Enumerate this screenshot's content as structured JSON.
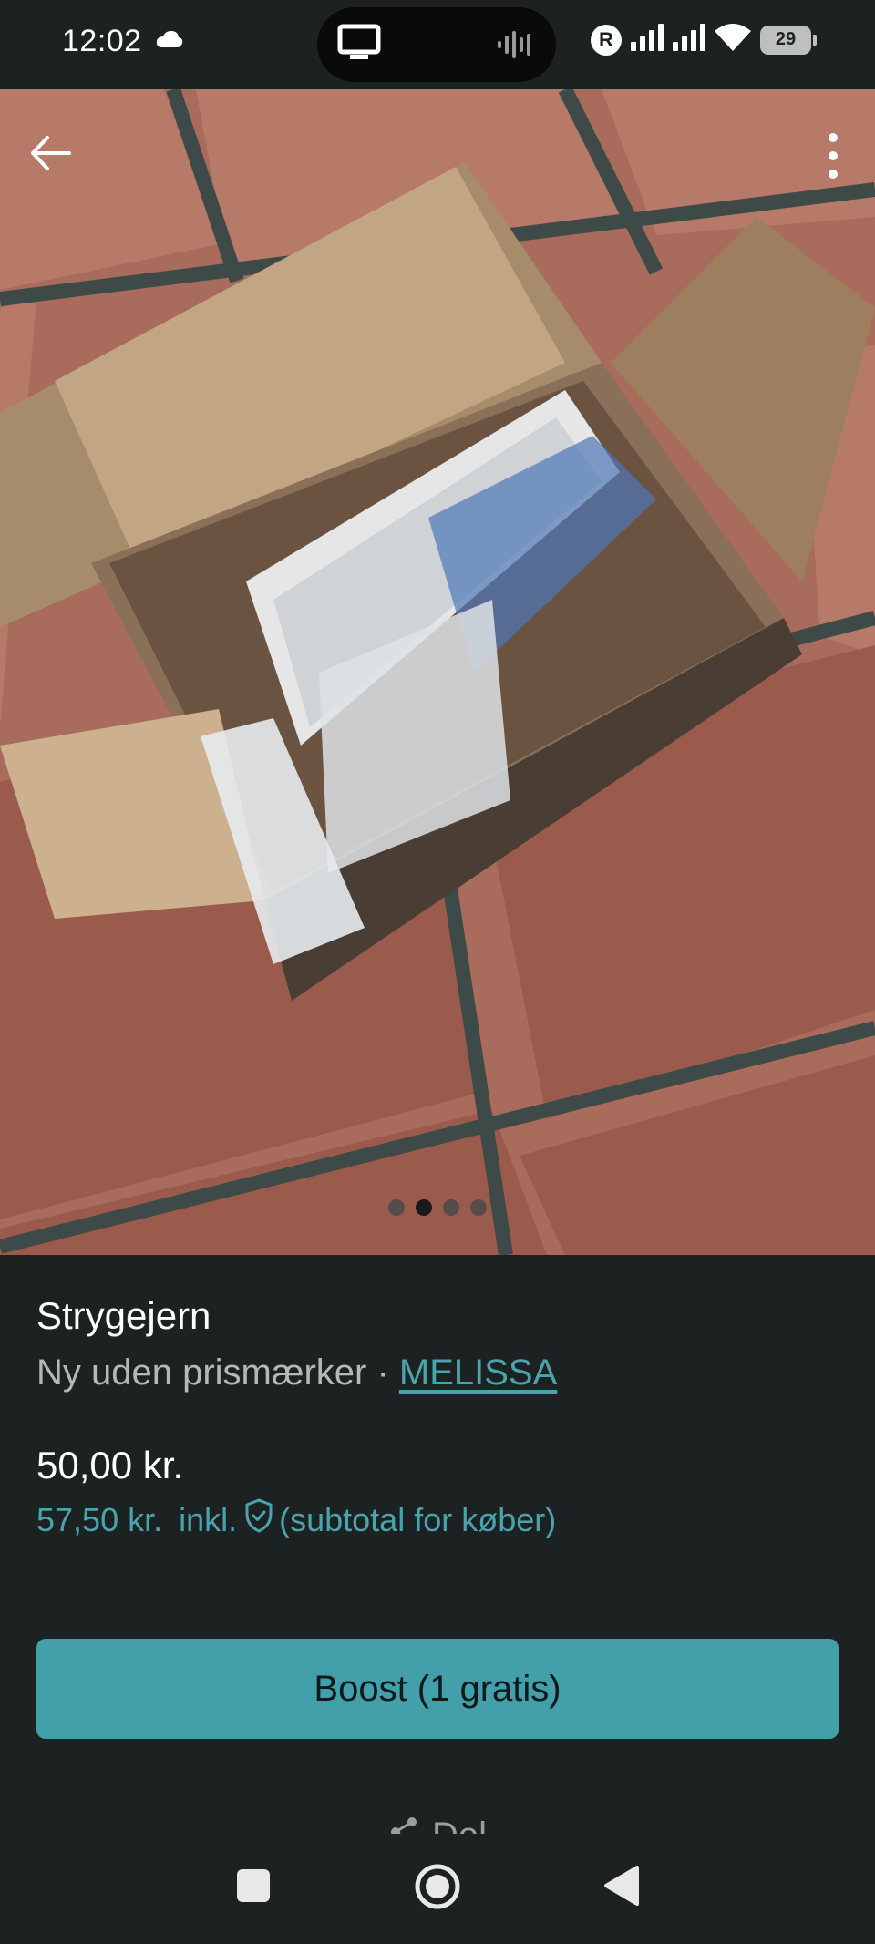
{
  "status_bar": {
    "time": "12:02",
    "battery": "29",
    "carrier_badge": "R",
    "icons": [
      "cloud-icon",
      "screen-cast-icon",
      "audio-wave-icon",
      "signal-icon",
      "signal-icon",
      "wifi-icon",
      "battery-icon"
    ]
  },
  "photo": {
    "dots_total": 4,
    "active_index": 1,
    "icons": [
      "back-arrow-icon",
      "more-vertical-icon"
    ]
  },
  "item": {
    "title": "Strygejern",
    "condition": "Ny uden prismærker",
    "separator": " · ",
    "brand": "MELISSA",
    "price": "50,00 kr.",
    "buyer_price": "57,50 kr.",
    "incl_label": "inkl.",
    "subtotal_label": "(subtotal for køber)"
  },
  "actions": {
    "boost_label": "Boost (1 gratis)",
    "share_label": "Del"
  },
  "colors": {
    "background": "#1b2221",
    "accent": "#43a0ab",
    "link": "#4aa4ae",
    "muted_text": "#b4b8b7"
  }
}
